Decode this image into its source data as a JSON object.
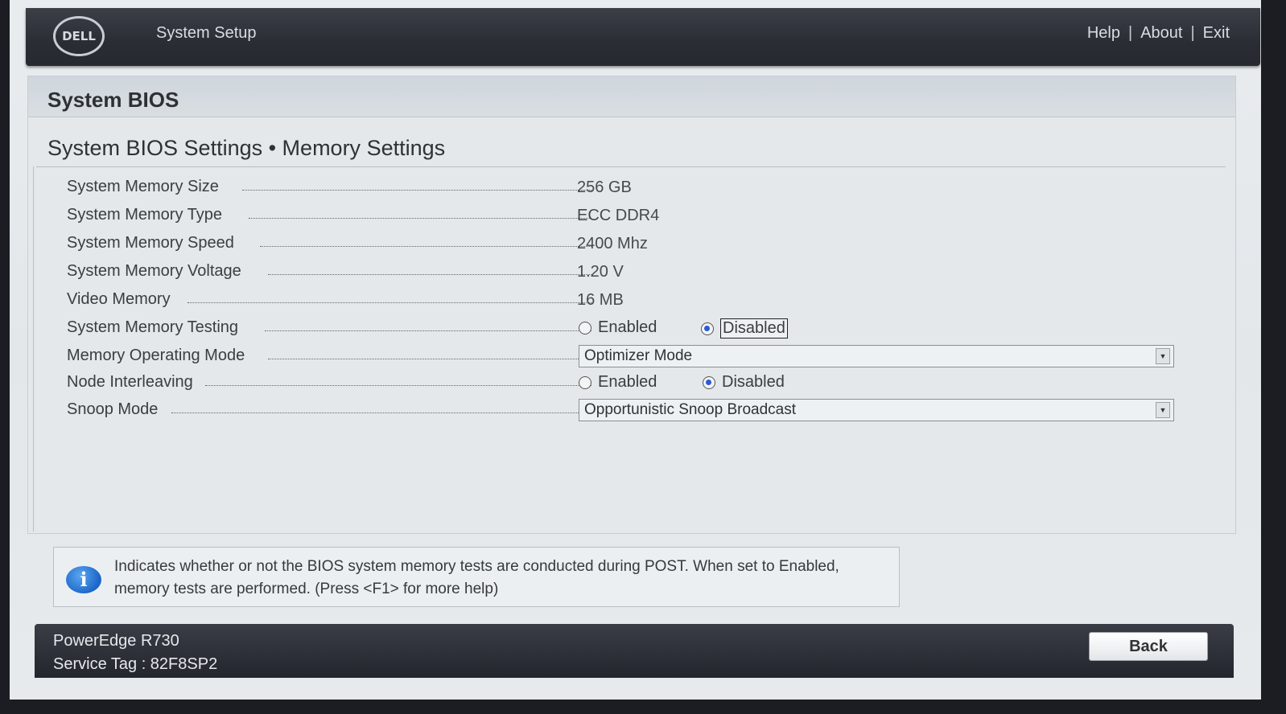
{
  "header": {
    "logo_text": "DELL",
    "app_title": "System Setup",
    "links": [
      "Help",
      "About",
      "Exit"
    ]
  },
  "panel": {
    "title": "System BIOS",
    "breadcrumb": "System BIOS Settings • Memory Settings"
  },
  "settings": {
    "memory_size": {
      "label": "System Memory Size",
      "value": "256 GB"
    },
    "memory_type": {
      "label": "System Memory Type",
      "value": "ECC DDR4"
    },
    "memory_speed": {
      "label": "System Memory Speed",
      "value": "2400 Mhz"
    },
    "memory_voltage": {
      "label": "System Memory Voltage",
      "value": "1.20 V"
    },
    "video_memory": {
      "label": "Video Memory",
      "value": "16 MB"
    },
    "memory_testing": {
      "label": "System Memory Testing",
      "option_enabled": "Enabled",
      "option_disabled": "Disabled",
      "selected": "Disabled"
    },
    "operating_mode": {
      "label": "Memory Operating Mode",
      "value": "Optimizer Mode"
    },
    "node_interleaving": {
      "label": "Node Interleaving",
      "option_enabled": "Enabled",
      "option_disabled": "Disabled",
      "selected": "Disabled"
    },
    "snoop_mode": {
      "label": "Snoop Mode",
      "value": "Opportunistic Snoop Broadcast"
    }
  },
  "help": {
    "icon": "info-icon",
    "text": "Indicates whether or not the BIOS system memory tests are conducted during POST. When set to Enabled, memory tests are performed. (Press <F1> for more help)"
  },
  "footer": {
    "model": "PowerEdge R730",
    "service_tag": "Service Tag : 82F8SP2",
    "back_label": "Back"
  },
  "colors": {
    "header_bg": "#2a2d34",
    "panel_bg": "#e4e8ea",
    "radio_selected": "#2a5bd8",
    "info_icon": "#1d66c9"
  }
}
